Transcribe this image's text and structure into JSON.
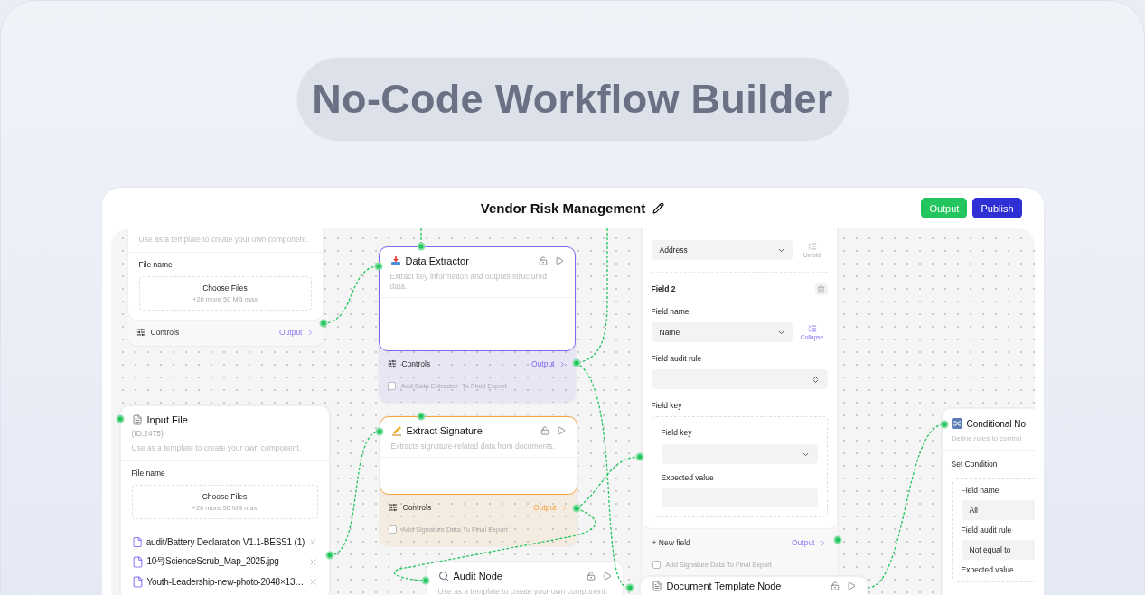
{
  "hero": {
    "title": "No-Code Workflow Builder"
  },
  "header": {
    "title": "Vendor Risk Management",
    "buttons": [
      {
        "label": "Output",
        "kind": "success"
      },
      {
        "label": "Publish",
        "kind": "primary"
      }
    ]
  },
  "nodes": [
    {
      "kind": "upload",
      "description": "Use as a template to create your own component.",
      "file_label": "File name",
      "dropzone": {
        "title": "Choose Files",
        "hint": "+20 more 50 MB max"
      },
      "footer": {
        "controls": "Controls",
        "output": "Output"
      }
    },
    {
      "kind": "process",
      "title": "Data Extractor",
      "color": "#7b68ee",
      "description": "Extract key information and outputs structured data.",
      "footer": {
        "controls": "Controls",
        "output": "Output",
        "checkbox": {
          "label": "Add Data Extractor  To Final Export",
          "checked": false
        }
      }
    },
    {
      "kind": "upload",
      "title": "Input File",
      "id": "(ID:2475)",
      "description": "Use as a template to create your own component.",
      "file_label": "File name",
      "dropzone": {
        "title": "Choose Files",
        "hint": "+20 more 50 MB max"
      },
      "files": [
        "audit/Battery Declaration V1.1-BESS1 (1)",
        "10号ScienceScrub_Map_2025.jpg",
        "Youth-Leadership-new-photo-2048×13…"
      ]
    },
    {
      "kind": "process",
      "title": "Extract Signature",
      "color": "#f5a142",
      "description": "Extracts signature-related data from documents.",
      "footer": {
        "controls": "Controls",
        "output": "Output",
        "checkbox": {
          "label": "Add Signature Data To Final Export",
          "checked": false
        }
      }
    },
    {
      "kind": "template",
      "title": "Audit Node",
      "description": "Use as a template to create your own component."
    },
    {
      "kind": "fields",
      "fields": [
        {
          "value": "Address",
          "toggle": "Unfold",
          "expanded": false
        },
        {
          "title": "Field 2",
          "name_label": "Field name",
          "value": "Name",
          "toggle": "Collapse",
          "expanded": true,
          "rule_label": "Field audit rule",
          "key_label": "Field key",
          "key_box": {
            "key_label": "Field key",
            "expected_label": "Expected value"
          }
        }
      ],
      "footer": {
        "new_field": "+ New field",
        "output": "Output",
        "checkbox": {
          "label": "Add Signature Data To Final Export",
          "checked": false
        }
      }
    },
    {
      "kind": "template",
      "title": "Document Template Node"
    },
    {
      "kind": "condition",
      "title": "Conditional No",
      "description": "Define rules to control",
      "section": "Set Condition",
      "rows": [
        {
          "label": "Field name",
          "value": "All"
        },
        {
          "label": "Field audit rule",
          "value": "Not equal to"
        },
        {
          "label": "Expected value"
        }
      ]
    }
  ]
}
